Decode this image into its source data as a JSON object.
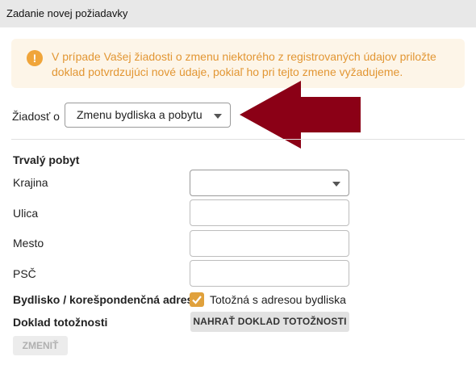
{
  "window": {
    "title": "Zadanie novej požiadavky"
  },
  "alert": {
    "icon": "exclamation-icon",
    "glyph": "!",
    "text": "V prípade Vašej žiadosti o zmenu niektorého z registrovaných údajov priložte doklad potvrdzujúci nové údaje, pokiaľ ho pri tejto zmene vyžadujeme.",
    "color": "#e29633",
    "background": "#fdf5e8"
  },
  "request": {
    "label": "Žiadosť o",
    "selected": "Zmenu bydliska a pobytu"
  },
  "annotation": {
    "icon": "arrow-left-icon",
    "color": "#8b0016"
  },
  "permanent_residence": {
    "heading": "Trvalý pobyt",
    "country": {
      "label": "Krajina",
      "selected": ""
    },
    "street": {
      "label": "Ulica",
      "value": ""
    },
    "city": {
      "label": "Mesto",
      "value": ""
    },
    "zip": {
      "label": "PSČ",
      "value": ""
    }
  },
  "correspondence": {
    "label": "Bydlisko / korešpondenčná adresa",
    "checkbox_label": "Totožná s adresou bydliska",
    "checked": true
  },
  "id_document": {
    "label": "Doklad totožnosti",
    "upload_label": "NAHRAŤ DOKLAD TOTOŽNOSTI"
  },
  "submit": {
    "label": "ZMENIŤ",
    "disabled": true
  },
  "colors": {
    "accent": "#e0a13c"
  }
}
